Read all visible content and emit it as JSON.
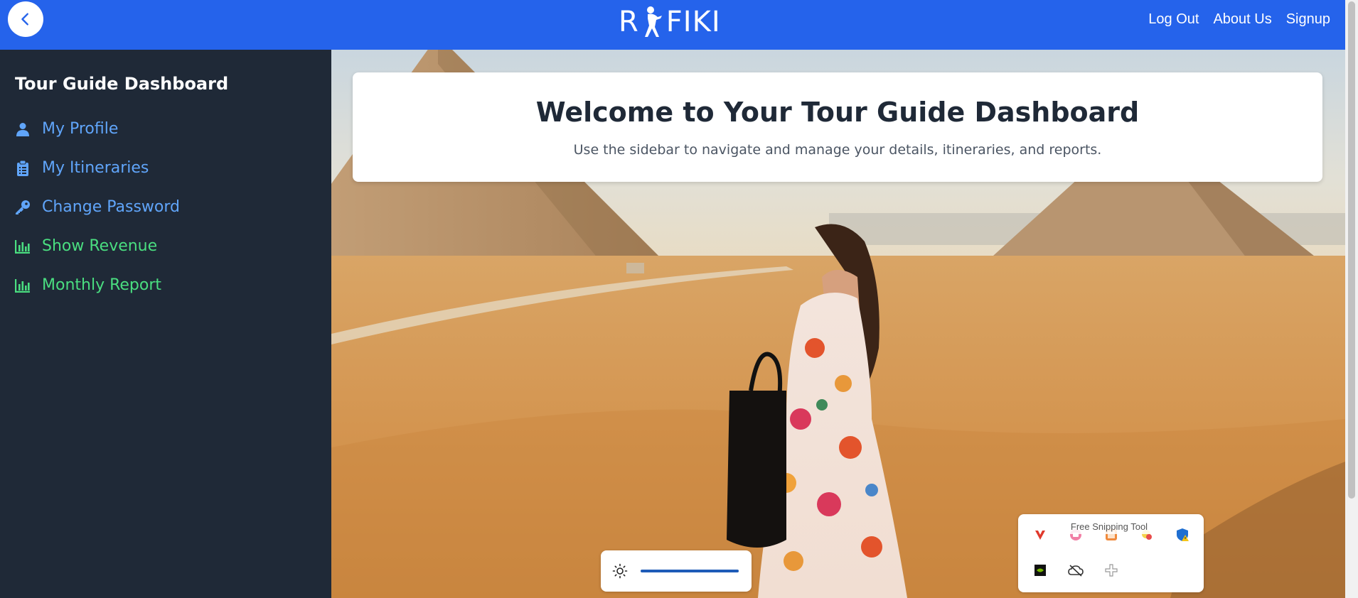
{
  "topbar": {
    "logo_text_left": "R",
    "logo_text_right": "FIKI",
    "links": [
      "Log Out",
      "About Us",
      "Signup"
    ],
    "accent": "#2563eb"
  },
  "sidebar": {
    "title": "Tour Guide Dashboard",
    "items": [
      {
        "label": "My Profile",
        "icon": "user-icon",
        "color": "#60a5fa"
      },
      {
        "label": "My Itineraries",
        "icon": "clipboard-icon",
        "color": "#60a5fa"
      },
      {
        "label": "Change Password",
        "icon": "key-icon",
        "color": "#60a5fa"
      },
      {
        "label": "Show Revenue",
        "icon": "bar-chart-icon",
        "color": "#4ade80"
      },
      {
        "label": "Monthly Report",
        "icon": "bar-chart-icon",
        "color": "#4ade80"
      }
    ],
    "background": "#1f2937"
  },
  "main": {
    "heading": "Welcome to Your Tour Guide Dashboard",
    "subheading": "Use the sidebar to navigate and manage your details, itineraries, and reports.",
    "background_image": "woman-in-floral-dress-at-giza-pyramids"
  },
  "system_overlays": {
    "brightness_level": 1.0,
    "tray_tooltip": "Free Snipping Tool",
    "tray_icons": [
      "vivaldi-icon",
      "app-icon",
      "snipping-tool-icon",
      "pointer-app-icon",
      "security-warning-icon",
      "nvidia-icon",
      "cloud-offline-icon",
      "add-icon"
    ]
  }
}
